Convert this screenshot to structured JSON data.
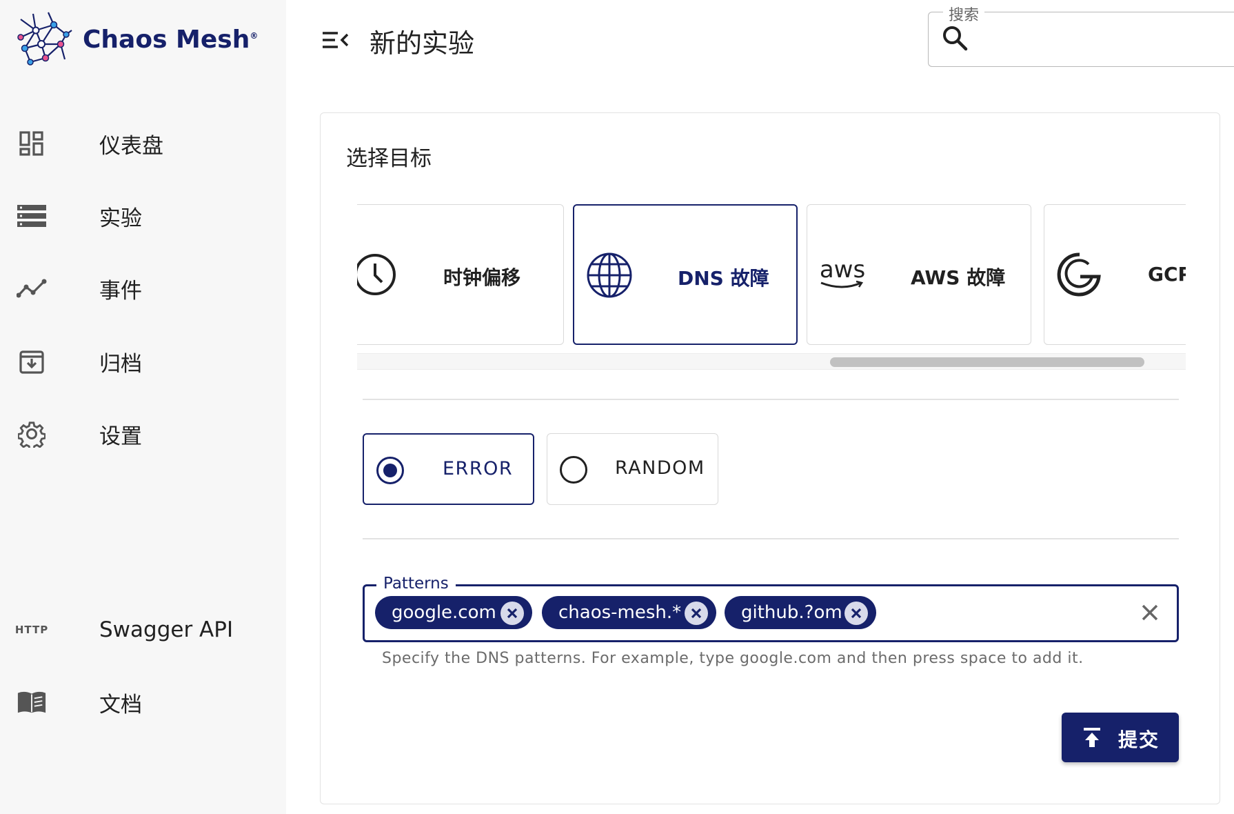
{
  "app": {
    "brand": "Chaos Mesh",
    "brand_mark": "®",
    "colors": {
      "primary": "#16216a",
      "sidebar_bg": "#f7f7f7",
      "chip_close_bg": "#d8daea",
      "text": "#212121"
    }
  },
  "sidebar": {
    "items": [
      {
        "label": "仪表盘",
        "icon": "dashboard-icon"
      },
      {
        "label": "实验",
        "icon": "list-icon"
      },
      {
        "label": "事件",
        "icon": "timeline-icon"
      },
      {
        "label": "归档",
        "icon": "archive-icon"
      },
      {
        "label": "设置",
        "icon": "gear-icon"
      },
      {
        "label": "Swagger API",
        "icon": "http-icon",
        "icon_text": "HTTP"
      },
      {
        "label": "文档",
        "icon": "book-icon"
      }
    ]
  },
  "header": {
    "title": "新的实验",
    "search": {
      "label": "搜索",
      "placeholder": "",
      "value": ""
    }
  },
  "main": {
    "section_title": "选择目标",
    "targets": [
      {
        "label": "时钟偏移",
        "icon": "clock-icon",
        "selected": false
      },
      {
        "label": "DNS 故障",
        "icon": "globe-icon",
        "selected": true
      },
      {
        "label": "AWS 故障",
        "icon": "aws-logo-icon",
        "icon_text": "aws",
        "selected": false
      },
      {
        "label": "GCP",
        "icon": "google-logo-icon",
        "selected": false
      }
    ],
    "actions": [
      {
        "label": "ERROR",
        "selected": true
      },
      {
        "label": "RANDOM",
        "selected": false
      }
    ],
    "patterns": {
      "label": "Patterns",
      "chips": [
        "google.com",
        "chaos-mesh.*",
        "github.?om"
      ],
      "helper": "Specify the DNS patterns. For example, type google.com and then press space to add it."
    },
    "submit_label": "提交"
  }
}
